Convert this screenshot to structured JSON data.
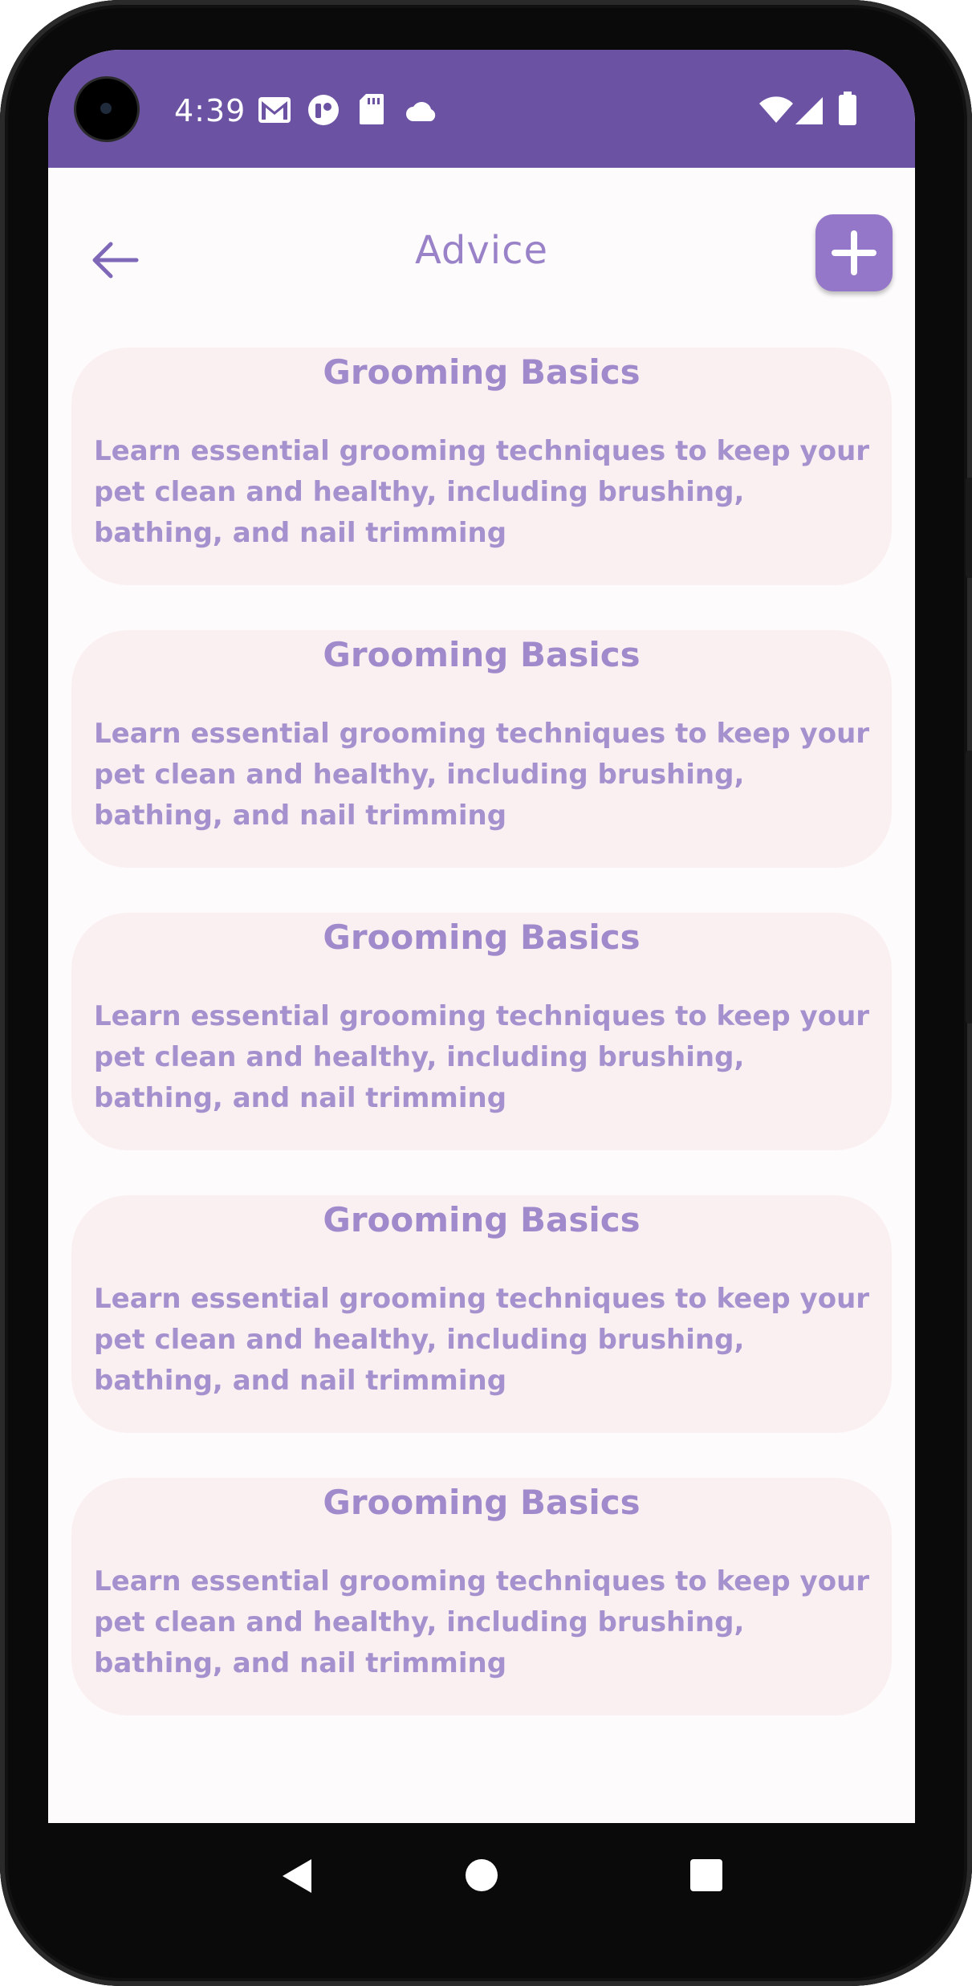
{
  "status_bar": {
    "time": "4:39",
    "icons": [
      "gmail-icon",
      "app-icon",
      "sd-card-icon",
      "cloud-icon"
    ],
    "right_icons": [
      "wifi-icon",
      "signal-icon",
      "battery-icon"
    ],
    "color": "#6b52a3"
  },
  "app_bar": {
    "title": "Advice",
    "back_icon": "back-arrow-icon",
    "add_icon": "plus-icon"
  },
  "cards": [
    {
      "title": "Grooming Basics",
      "description": "Learn essential grooming techniques to keep your pet clean and healthy, including brushing, bathing, and nail trimming"
    },
    {
      "title": "Grooming Basics",
      "description": "Learn essential grooming techniques to keep your pet clean and healthy, including brushing, bathing, and nail trimming"
    },
    {
      "title": "Grooming Basics",
      "description": "Learn essential grooming techniques to keep your pet clean and healthy, including brushing, bathing, and nail trimming"
    },
    {
      "title": "Grooming Basics",
      "description": "Learn essential grooming techniques to keep your pet clean and healthy, including brushing, bathing, and nail trimming"
    },
    {
      "title": "Grooming Basics",
      "description": "Learn essential grooming techniques to keep your pet clean and healthy, including brushing, bathing, and nail trimming"
    }
  ],
  "nav_bar": {
    "icons": [
      "nav-back-icon",
      "nav-home-icon",
      "nav-recents-icon"
    ]
  },
  "colors": {
    "accent": "#9a82c8",
    "card_bg": "#fbf0f1",
    "card_text": "#a691cf"
  }
}
